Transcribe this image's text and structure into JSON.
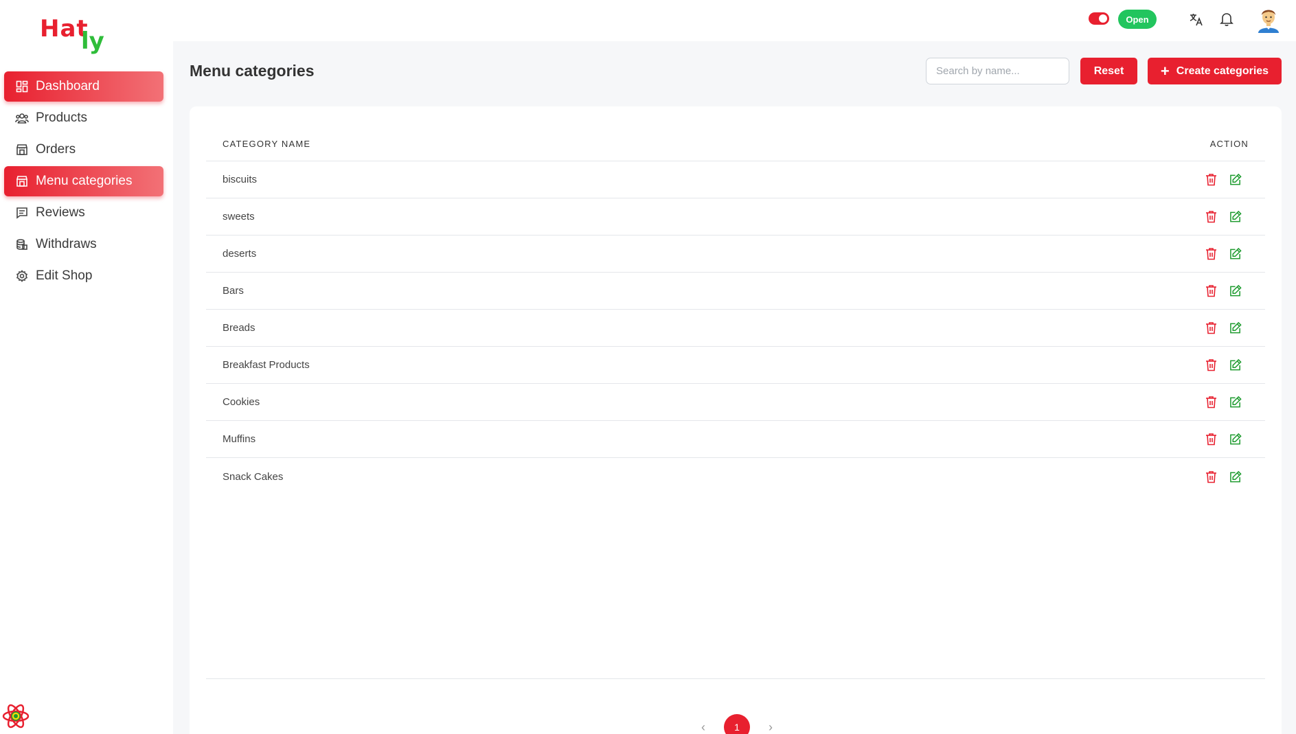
{
  "brand": {
    "logo_part1": "Hat",
    "logo_part2": "ly"
  },
  "sidebar": {
    "items": [
      {
        "label": "Dashboard",
        "icon": "dashboard-icon",
        "active": true
      },
      {
        "label": "Products",
        "icon": "users-icon",
        "active": false
      },
      {
        "label": "Orders",
        "icon": "store-icon",
        "active": false
      },
      {
        "label": "Menu categories",
        "icon": "store-icon",
        "active": true
      },
      {
        "label": "Reviews",
        "icon": "message-icon",
        "active": false
      },
      {
        "label": "Withdraws",
        "icon": "database-icon",
        "active": false
      },
      {
        "label": "Edit Shop",
        "icon": "gear-icon",
        "active": false
      }
    ]
  },
  "topbar": {
    "shop_status": "Open",
    "toggle_on": true,
    "icons": [
      "translate-icon",
      "bell-icon",
      "avatar"
    ]
  },
  "page": {
    "title": "Menu categories",
    "search_placeholder": "Search by name...",
    "reset_label": "Reset",
    "create_label": "Create categories"
  },
  "table": {
    "headers": {
      "name": "CATEGORY NAME",
      "action": "ACTION"
    },
    "rows": [
      {
        "name": "biscuits"
      },
      {
        "name": "sweets"
      },
      {
        "name": "deserts"
      },
      {
        "name": "Bars"
      },
      {
        "name": "Breads"
      },
      {
        "name": "Breakfast Products"
      },
      {
        "name": "Cookies"
      },
      {
        "name": "Muffins"
      },
      {
        "name": "Snack Cakes"
      }
    ]
  },
  "pagination": {
    "prev": "‹",
    "current": "1",
    "next": "›"
  },
  "colors": {
    "primary": "#e8202f",
    "success": "#22c55e",
    "edit": "#1e9b2f"
  }
}
